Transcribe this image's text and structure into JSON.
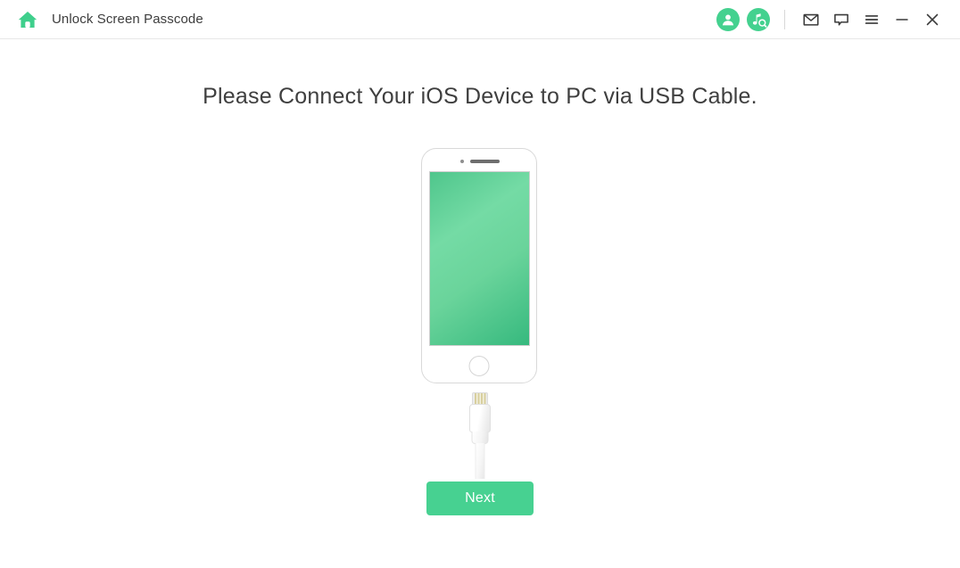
{
  "titlebar": {
    "home_icon": "home-icon",
    "app_title": "Unlock Screen Passcode",
    "right_icons": [
      {
        "name": "account-icon",
        "label": "Account"
      },
      {
        "name": "music-search-icon",
        "label": "Music Search"
      },
      {
        "name": "mail-icon",
        "label": "Mail"
      },
      {
        "name": "feedback-icon",
        "label": "Feedback"
      },
      {
        "name": "menu-icon",
        "label": "Menu"
      },
      {
        "name": "minimize-icon",
        "label": "Minimize"
      },
      {
        "name": "close-icon",
        "label": "Close"
      }
    ]
  },
  "main": {
    "headline": "Please Connect Your iOS Device to PC via USB Cable.",
    "device_illustration": {
      "name": "ios-device-illustration",
      "screen_gradient_from": "#74dba5",
      "screen_gradient_to": "#36b97e",
      "cable": "lightning-cable"
    },
    "next_label": "Next"
  },
  "colors": {
    "accent_green": "#47d191",
    "icon_dark": "#3a3a3a",
    "text_dark": "#3f3f3f",
    "border_light": "#e7e7e7"
  }
}
